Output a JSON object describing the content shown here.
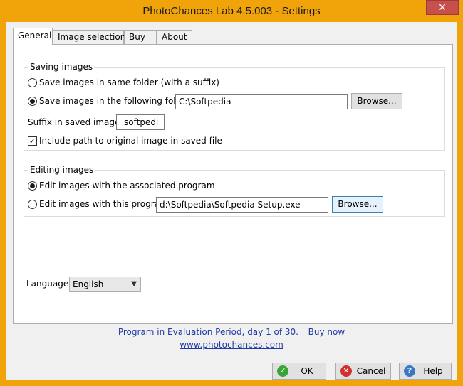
{
  "window": {
    "title": "PhotoChances Lab 4.5.003  -  Settings",
    "close_glyph": "✕"
  },
  "tabs": [
    {
      "label": "General",
      "active": true
    },
    {
      "label": "Image selection",
      "active": false
    },
    {
      "label": "Buy",
      "active": false
    },
    {
      "label": "About",
      "active": false
    }
  ],
  "saving": {
    "group_label": "Saving images",
    "option_same_folder": "Save images in same folder (with a suffix)",
    "option_following_folder": "Save images in the following folder:",
    "folder_value": "C:\\Softpedia",
    "browse_label": "Browse...",
    "suffix_label": "Suffix in saved images:",
    "suffix_value": "_softpedi",
    "include_path_label": "Include path to original image in saved file",
    "include_path_checked": "✓"
  },
  "editing": {
    "group_label": "Editing images",
    "option_associated": "Edit images with the associated program",
    "option_this_program": "Edit images with this program:",
    "program_value": "d:\\Softpedia\\Softpedia Setup.exe",
    "browse_label": "Browse..."
  },
  "language": {
    "label": "Language:",
    "selected": "English",
    "arrow": "▼"
  },
  "status": {
    "evaluation_text": "Program in Evaluation Period, day 1 of 30.",
    "buy_now": "Buy now",
    "website": "www.photochances.com"
  },
  "buttons": {
    "ok": "OK",
    "cancel": "Cancel",
    "help": "Help",
    "ok_icon_glyph": "✓",
    "cancel_icon_glyph": "✕",
    "help_icon_glyph": "?"
  },
  "colors": {
    "titlebar": "#f0a40a",
    "close": "#c7504c",
    "link": "#1f3aa5",
    "ok_icon": "#3aa535",
    "cancel_icon": "#d0312d",
    "help_icon": "#3a78c4"
  }
}
